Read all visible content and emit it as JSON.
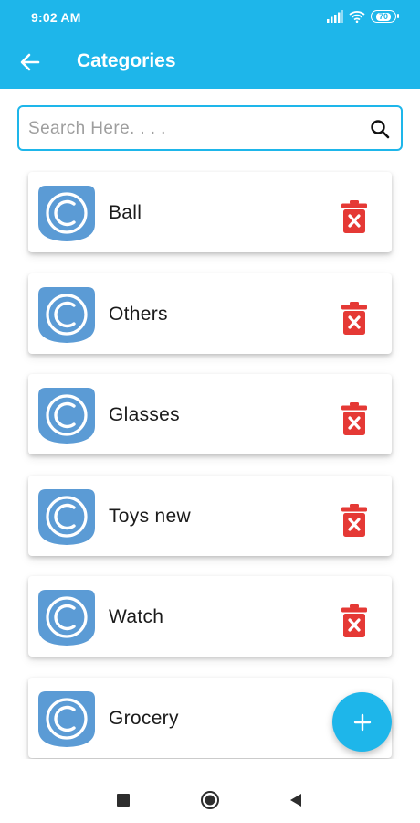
{
  "status_bar": {
    "time": "9:02 AM",
    "battery": "70",
    "icons": [
      "signal-icon",
      "wifi-icon",
      "battery-icon"
    ]
  },
  "app_bar": {
    "title": "Categories",
    "back_icon": "arrow-back-icon",
    "color": "#1eb6ea"
  },
  "search": {
    "placeholder": "Search Here. . . .",
    "value": "",
    "icon": "search-icon"
  },
  "categories": [
    {
      "name": "Ball"
    },
    {
      "name": "Others"
    },
    {
      "name": "Glasses"
    },
    {
      "name": "Toys new"
    },
    {
      "name": "Watch"
    },
    {
      "name": "Grocery"
    }
  ],
  "colors": {
    "accent": "#1eb6ea",
    "delete": "#e53935",
    "logo": "#5b9bd5"
  },
  "fab": {
    "icon": "plus-icon"
  },
  "nav_bar": {
    "icons": [
      "recent-apps-icon",
      "home-icon",
      "back-icon"
    ]
  }
}
